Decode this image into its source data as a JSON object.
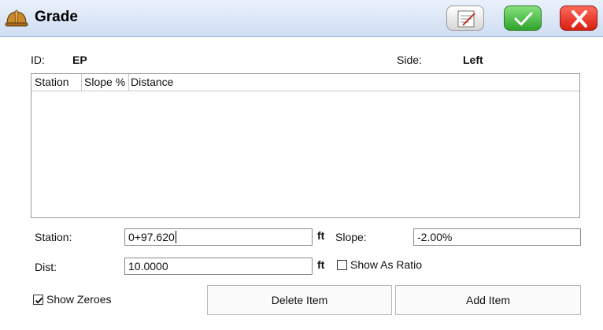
{
  "window": {
    "title": "Grade",
    "icon": "hard-hat-icon",
    "buttons": {
      "notes_icon": "notes-icon",
      "ok_icon": "checkmark-icon",
      "cancel_icon": "close-icon"
    }
  },
  "header": {
    "id_label": "ID:",
    "id_value": "EP",
    "side_label": "Side:",
    "side_value": "Left"
  },
  "table": {
    "columns": [
      "Station",
      "Slope %",
      "Distance"
    ],
    "rows": []
  },
  "form": {
    "station_label": "Station:",
    "station_value": "0+97.620",
    "station_unit": "ft",
    "slope_label": "Slope:",
    "slope_value": "-2.00%",
    "dist_label": "Dist:",
    "dist_value": "10.0000",
    "dist_unit": "ft",
    "show_as_ratio_label": "Show As Ratio",
    "show_as_ratio_checked": false
  },
  "footer": {
    "show_zeroes_label": "Show Zeroes",
    "show_zeroes_checked": true,
    "delete_label": "Delete Item",
    "add_label": "Add Item"
  },
  "colors": {
    "ok_green": "#2fa42b",
    "cancel_red": "#d81e10",
    "titlebar": "#cfdef3"
  }
}
